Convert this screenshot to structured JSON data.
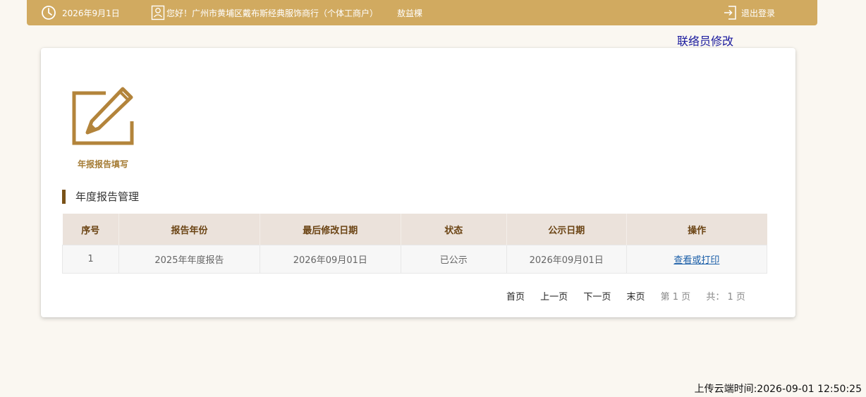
{
  "header": {
    "date": "2026年9月1日",
    "greeting": "您好！广州市黄埔区戴布斯经典服饰商行（个体工商户）",
    "user_name": "敖益棵",
    "logout_label": "退出登录"
  },
  "contact_edit_label": "联络员修改",
  "tile": {
    "label": "年报报告填写"
  },
  "section": {
    "title": "年度报告管理"
  },
  "table": {
    "columns": [
      "序号",
      "报告年份",
      "最后修改日期",
      "状态",
      "公示日期",
      "操作"
    ],
    "rows": [
      {
        "index": "1",
        "year": "2025年年度报告",
        "modified": "2026年09月01日",
        "status": "已公示",
        "publish_date": "2026年09月01日",
        "action": "查看或打印"
      }
    ]
  },
  "pager": {
    "first": "首页",
    "prev": "上一页",
    "next": "下一页",
    "last": "末页",
    "current": "第 1 页",
    "total": "共： 1 页"
  },
  "footer": {
    "upload_time": "上传云端时间:2026-09-01 12:50:25"
  },
  "colors": {
    "header_bg": "#d1aa60",
    "accent": "#a57c35",
    "link": "#1a5ea8"
  }
}
